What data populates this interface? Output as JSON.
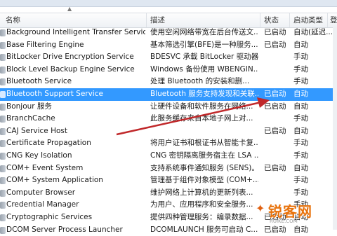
{
  "header": {
    "columns": [
      "名称",
      "描述",
      "状态",
      "启动类型",
      "登"
    ]
  },
  "services": [
    {
      "name": "Background Intelligent Transfer Service",
      "desc": "使用空闲网络带宽在后台传送文...",
      "status": "已启动",
      "start": "自动(延迟..."
    },
    {
      "name": "Base Filtering Engine",
      "desc": "基本筛选引擎(BFE)是一种服务...",
      "status": "已启动",
      "start": "自动"
    },
    {
      "name": "BitLocker Drive Encryption Service",
      "desc": "BDESVC 承载 BitLocker 驱动器...",
      "status": "",
      "start": "手动"
    },
    {
      "name": "Block Level Backup Engine Service",
      "desc": "Windows 备份使用 WBENGIN...",
      "status": "",
      "start": "手动"
    },
    {
      "name": "Bluetooth Service",
      "desc": "处理 Bluetooth 的安装和删...",
      "status": "",
      "start": "手动"
    },
    {
      "name": "Bluetooth Support Service",
      "desc": "Bluetooth 服务支持发现和关联...",
      "status": "已启动",
      "start": "自动"
    },
    {
      "name": "Bonjour 服务",
      "desc": "让硬件设备和软件服务在网络...",
      "status": "已启动",
      "start": "自动"
    },
    {
      "name": "BranchCache",
      "desc": "此服务缓存来自本地子网上对...",
      "status": "",
      "start": "手动"
    },
    {
      "name": "CAJ Service Host",
      "desc": "",
      "status": "已启动",
      "start": "自动"
    },
    {
      "name": "Certificate Propagation",
      "desc": "将用户证书和根证书从智能卡复...",
      "status": "",
      "start": "手动"
    },
    {
      "name": "CNG Key Isolation",
      "desc": "CNG 密钥隔离服务宿主在 LSA ...",
      "status": "",
      "start": "手动"
    },
    {
      "name": "COM+ Event System",
      "desc": "支持系统事件通知服务 (SENS)。...",
      "status": "已启动",
      "start": "自动"
    },
    {
      "name": "COM+ System Application",
      "desc": "管理基于组件对象模型 (COM+...",
      "status": "",
      "start": "手动"
    },
    {
      "name": "Computer Browser",
      "desc": "维护网络上计算机的更新列表...",
      "status": "",
      "start": "手动"
    },
    {
      "name": "Credential Manager",
      "desc": "为用户、应用程序和安全服务...",
      "status": "",
      "start": "手动"
    },
    {
      "name": "Cryptographic Services",
      "desc": "提供四种管理服务：编录数据...",
      "status": "已启动",
      "start": "自动"
    },
    {
      "name": "DCOM Server Process Launcher",
      "desc": "DCOMLAUNCH 服务可启动 C...",
      "status": "已启动",
      "start": "自动"
    }
  ],
  "selected_index": 5,
  "watermark": {
    "text": "锐客网",
    "sub": "RUIKE.COM"
  },
  "colors": {
    "selection": "#3399ff",
    "arrow": "#c0282a"
  }
}
